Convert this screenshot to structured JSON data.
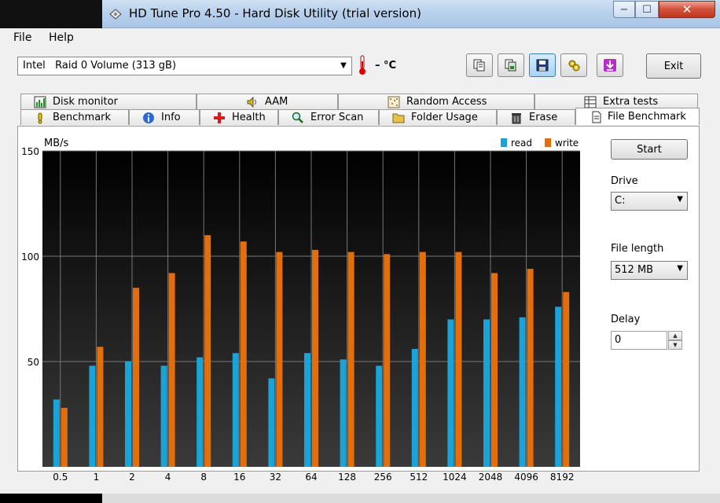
{
  "window": {
    "title": "HD Tune Pro 4.50 - Hard Disk Utility (trial version)",
    "min_symbol": "−",
    "max_symbol": "☐",
    "close_symbol": "✕"
  },
  "menu": {
    "file": "File",
    "help": "Help"
  },
  "toolbar": {
    "drive_value": "Intel   Raid 0 Volume (313 gB)",
    "temperature": "– °C",
    "exit_label": "Exit",
    "icons": [
      "copy-text-icon",
      "copy-screenshot-icon",
      "save-icon",
      "options-icon",
      "download-icon"
    ]
  },
  "tabs": {
    "row1": [
      {
        "label": "Disk monitor",
        "icon": "disk-monitor-icon"
      },
      {
        "label": "AAM",
        "icon": "speaker-icon"
      },
      {
        "label": "Random Access",
        "icon": "random-access-icon"
      },
      {
        "label": "Extra tests",
        "icon": "extra-tests-icon"
      }
    ],
    "row2": [
      {
        "label": "Benchmark",
        "icon": "benchmark-icon"
      },
      {
        "label": "Info",
        "icon": "info-icon"
      },
      {
        "label": "Health",
        "icon": "health-cross-icon"
      },
      {
        "label": "Error Scan",
        "icon": "magnifier-icon"
      },
      {
        "label": "Folder Usage",
        "icon": "folder-icon"
      },
      {
        "label": "Erase",
        "icon": "trash-icon"
      },
      {
        "label": "File Benchmark",
        "icon": "file-benchmark-icon"
      }
    ]
  },
  "side": {
    "start_label": "Start",
    "drive_label": "Drive",
    "drive_value": "C:",
    "file_length_label": "File length",
    "file_length_value": "512 MB",
    "delay_label": "Delay",
    "delay_value": "0"
  },
  "colors": {
    "read": "#1aa3d6",
    "write": "#e36e0a",
    "plot_bg_top": "#000000",
    "plot_bg_bottom": "#3a3a3a"
  },
  "chart_data": {
    "type": "bar",
    "ylabel": "MB/s",
    "ylim": [
      0,
      150
    ],
    "yticks": [
      "150",
      "100",
      "50"
    ],
    "categories": [
      "0.5",
      "1",
      "2",
      "4",
      "8",
      "16",
      "32",
      "64",
      "128",
      "256",
      "512",
      "1024",
      "2048",
      "4096",
      "8192"
    ],
    "legend": [
      "read",
      "write"
    ],
    "legend_position": "top-right",
    "grid": true,
    "series": [
      {
        "name": "read",
        "values": [
          32,
          48,
          50,
          48,
          52,
          54,
          42,
          54,
          51,
          48,
          56,
          70,
          70,
          71,
          76
        ]
      },
      {
        "name": "write",
        "values": [
          28,
          57,
          85,
          92,
          110,
          107,
          102,
          103,
          102,
          101,
          102,
          102,
          92,
          94,
          83
        ]
      }
    ]
  }
}
